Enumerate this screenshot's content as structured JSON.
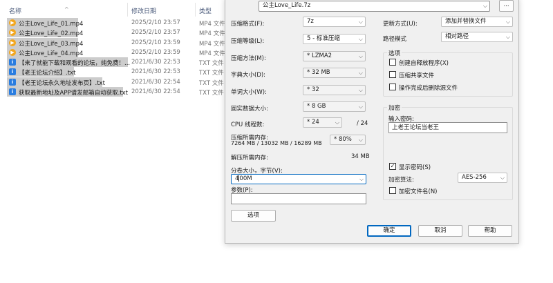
{
  "explorer": {
    "columns": {
      "name": "名称",
      "modified": "修改日期",
      "type": "类型"
    },
    "files": [
      {
        "name": "公主Love_Life_01.mp4",
        "date": "2025/2/10 23:57",
        "type": "MP4 文件",
        "icon": "vlc-media-icon"
      },
      {
        "name": "公主Love_Life_02.mp4",
        "date": "2025/2/10 23:57",
        "type": "MP4 文件",
        "icon": "vlc-media-icon"
      },
      {
        "name": "公主Love_Life_03.mp4",
        "date": "2025/2/10 23:59",
        "type": "MP4 文件",
        "icon": "vlc-media-icon"
      },
      {
        "name": "公主Love_Life_04.mp4",
        "date": "2025/2/10 23:59",
        "type": "MP4 文件",
        "icon": "vlc-media-icon"
      },
      {
        "name": "【来了就能下载和观看的论坛，纯免费！...",
        "date": "2021/6/30 22:53",
        "type": "TXT 文件",
        "icon": "text-file-icon"
      },
      {
        "name": "【老王论坛介绍】.txt",
        "date": "2021/6/30 22:53",
        "type": "TXT 文件",
        "icon": "text-file-icon"
      },
      {
        "name": "【老王论坛永久地址发布页】.txt",
        "date": "2021/6/30 22:54",
        "type": "TXT 文件",
        "icon": "text-file-icon"
      },
      {
        "name": "获取最新地址及APP请发邮箱自动获取.txt",
        "date": "2021/6/30 22:54",
        "type": "TXT 文件",
        "icon": "text-file-icon"
      }
    ]
  },
  "dialog": {
    "archive_path": "公主Love_Life.7z",
    "browse_label": "...",
    "left": {
      "format": {
        "label": "压缩格式(F):",
        "value": "7z"
      },
      "level": {
        "label": "压缩等级(L):",
        "value": "5 - 标准压缩"
      },
      "method": {
        "label": "压缩方法(M):",
        "value": "* LZMA2"
      },
      "dict": {
        "label": "字典大小(D):",
        "value": "* 32 MB"
      },
      "word": {
        "label": "单词大小(W):",
        "value": "* 32"
      },
      "solid": {
        "label": "固实数据大小:",
        "value": "* 8 GB"
      },
      "threads": {
        "label": "CPU 线程数:",
        "value": "* 24",
        "total": "/ 24"
      },
      "mem_compress": {
        "label": "压缩所需内存:",
        "detail": "7264 MB / 13032 MB / 16289 MB",
        "percent": "* 80%"
      },
      "mem_decompress": {
        "label": "解压所需内存:",
        "value": "34 MB"
      },
      "volume": {
        "label": "分卷大小，字节(V):",
        "value_before_caret": "4",
        "value_after_caret": "00M"
      },
      "params": {
        "label": "参数(P):",
        "value": ""
      },
      "options_button": "选项"
    },
    "right": {
      "update_mode": {
        "label": "更新方式(U):",
        "value": "添加并替换文件"
      },
      "path_mode": {
        "label": "路径模式",
        "value": "相对路径"
      },
      "options_group": {
        "title": "选项",
        "sfx": "创建自释放程序(X)",
        "shared": "压缩共享文件",
        "delete_after": "操作完成后删除源文件"
      },
      "encryption": {
        "title": "加密",
        "password_label": "输入密码:",
        "password": "上老王论坛当老王",
        "show_password": "显示密码(S)",
        "method_label": "加密算法:",
        "method_value": "AES-256",
        "encrypt_names": "加密文件名(N)"
      }
    },
    "buttons": {
      "ok": "确定",
      "cancel": "取消",
      "help": "帮助"
    }
  }
}
